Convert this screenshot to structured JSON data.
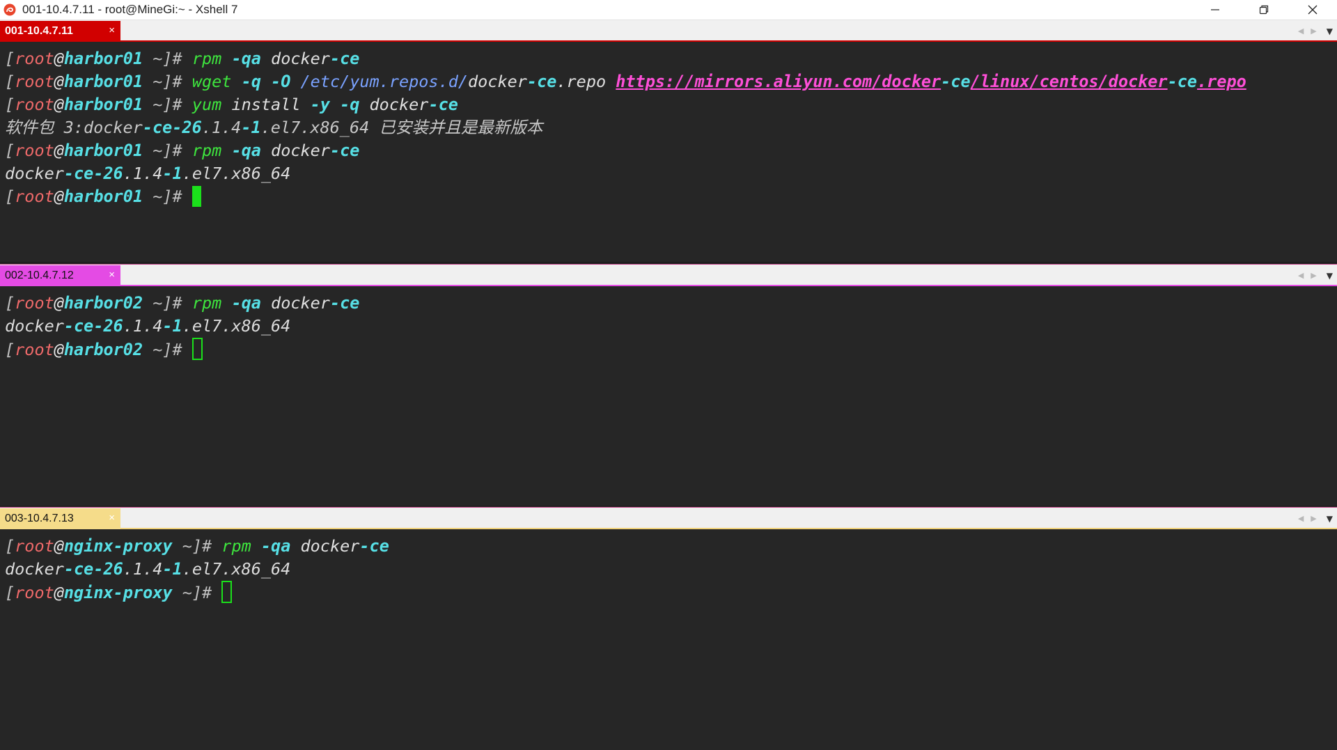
{
  "window": {
    "title": "001-10.4.7.11 - root@MineGi:~ - Xshell 7",
    "icon": "xshell-logo-icon",
    "controls": [
      "minimize-icon",
      "restore-icon",
      "close-icon"
    ]
  },
  "panes": [
    {
      "tab_label": "001-10.4.7.11",
      "tab_close": "×",
      "tab_color": "#d10000",
      "active": true,
      "lines": [
        [
          {
            "t": "[",
            "c": "br"
          },
          {
            "t": "root",
            "c": "user"
          },
          {
            "t": "@",
            "c": "at"
          },
          {
            "t": "harbor01",
            "c": "host"
          },
          {
            "t": " ~",
            "c": "tilde"
          },
          {
            "t": "]#",
            "c": "hash"
          },
          {
            "t": " ",
            "c": "arg"
          },
          {
            "t": "rpm",
            "c": "cmd"
          },
          {
            "t": " ",
            "c": "arg"
          },
          {
            "t": "-qa",
            "c": "flag"
          },
          {
            "t": " docker",
            "c": "arg"
          },
          {
            "t": "-ce",
            "c": "flag"
          }
        ],
        [
          {
            "t": "[",
            "c": "br"
          },
          {
            "t": "root",
            "c": "user"
          },
          {
            "t": "@",
            "c": "at"
          },
          {
            "t": "harbor01",
            "c": "host"
          },
          {
            "t": " ~",
            "c": "tilde"
          },
          {
            "t": "]#",
            "c": "hash"
          },
          {
            "t": " ",
            "c": "arg"
          },
          {
            "t": "wget",
            "c": "cmd"
          },
          {
            "t": " ",
            "c": "arg"
          },
          {
            "t": "-q",
            "c": "flag"
          },
          {
            "t": " ",
            "c": "arg"
          },
          {
            "t": "-O",
            "c": "flag"
          },
          {
            "t": " ",
            "c": "arg"
          },
          {
            "t": "/etc/yum.repos.d/",
            "c": "path"
          },
          {
            "t": "docker",
            "c": "arg"
          },
          {
            "t": "-ce",
            "c": "flag"
          },
          {
            "t": ".repo ",
            "c": "arg"
          },
          {
            "t": "https://mirrors.aliyun.com/docker",
            "c": "url"
          },
          {
            "t": "-ce",
            "c": "cyanb"
          },
          {
            "t": "/linux/centos/docker",
            "c": "url"
          },
          {
            "t": "-ce",
            "c": "cyanb"
          },
          {
            "t": ".repo",
            "c": "url"
          }
        ],
        [
          {
            "t": "[",
            "c": "br"
          },
          {
            "t": "root",
            "c": "user"
          },
          {
            "t": "@",
            "c": "at"
          },
          {
            "t": "harbor01",
            "c": "host"
          },
          {
            "t": " ~",
            "c": "tilde"
          },
          {
            "t": "]#",
            "c": "hash"
          },
          {
            "t": " ",
            "c": "arg"
          },
          {
            "t": "yum",
            "c": "cmd"
          },
          {
            "t": " install ",
            "c": "arg"
          },
          {
            "t": "-y",
            "c": "flag"
          },
          {
            "t": " ",
            "c": "arg"
          },
          {
            "t": "-q",
            "c": "flag"
          },
          {
            "t": " docker",
            "c": "arg"
          },
          {
            "t": "-ce",
            "c": "flag"
          }
        ],
        [
          {
            "t": "软件包 3:docker",
            "c": "note"
          },
          {
            "t": "-ce-26",
            "c": "num"
          },
          {
            "t": ".1.4",
            "c": "note"
          },
          {
            "t": "-1",
            "c": "num"
          },
          {
            "t": ".el7.x86_64 已安装并且是最新版本",
            "c": "note"
          }
        ],
        [
          {
            "t": "[",
            "c": "br"
          },
          {
            "t": "root",
            "c": "user"
          },
          {
            "t": "@",
            "c": "at"
          },
          {
            "t": "harbor01",
            "c": "host"
          },
          {
            "t": " ~",
            "c": "tilde"
          },
          {
            "t": "]#",
            "c": "hash"
          },
          {
            "t": " ",
            "c": "arg"
          },
          {
            "t": "rpm",
            "c": "cmd"
          },
          {
            "t": " ",
            "c": "arg"
          },
          {
            "t": "-qa",
            "c": "flag"
          },
          {
            "t": " docker",
            "c": "arg"
          },
          {
            "t": "-ce",
            "c": "flag"
          }
        ],
        [
          {
            "t": "docker",
            "c": "out"
          },
          {
            "t": "-ce-26",
            "c": "num"
          },
          {
            "t": ".1.4",
            "c": "out"
          },
          {
            "t": "-1",
            "c": "num"
          },
          {
            "t": ".el7.x86_64",
            "c": "out"
          }
        ],
        [
          {
            "t": "[",
            "c": "br"
          },
          {
            "t": "root",
            "c": "user"
          },
          {
            "t": "@",
            "c": "at"
          },
          {
            "t": "harbor01",
            "c": "host"
          },
          {
            "t": " ~",
            "c": "tilde"
          },
          {
            "t": "]#",
            "c": "hash"
          },
          {
            "t": " ",
            "c": "arg"
          },
          {
            "cursor": "solid"
          }
        ]
      ]
    },
    {
      "tab_label": "002-10.4.7.12",
      "tab_close": "×",
      "tab_color": "#e44be4",
      "active": false,
      "lines": [
        [
          {
            "t": "[",
            "c": "br"
          },
          {
            "t": "root",
            "c": "user"
          },
          {
            "t": "@",
            "c": "at"
          },
          {
            "t": "harbor02",
            "c": "host"
          },
          {
            "t": " ~",
            "c": "tilde"
          },
          {
            "t": "]#",
            "c": "hash"
          },
          {
            "t": " ",
            "c": "arg"
          },
          {
            "t": "rpm",
            "c": "cmd"
          },
          {
            "t": " ",
            "c": "arg"
          },
          {
            "t": "-qa",
            "c": "flag"
          },
          {
            "t": " docker",
            "c": "arg"
          },
          {
            "t": "-ce",
            "c": "flag"
          }
        ],
        [
          {
            "t": "docker",
            "c": "out"
          },
          {
            "t": "-ce-26",
            "c": "num"
          },
          {
            "t": ".1.4",
            "c": "out"
          },
          {
            "t": "-1",
            "c": "num"
          },
          {
            "t": ".el7.x86_64",
            "c": "out"
          }
        ],
        [
          {
            "t": "[",
            "c": "br"
          },
          {
            "t": "root",
            "c": "user"
          },
          {
            "t": "@",
            "c": "at"
          },
          {
            "t": "harbor02",
            "c": "host"
          },
          {
            "t": " ~",
            "c": "tilde"
          },
          {
            "t": "]#",
            "c": "hash"
          },
          {
            "t": " ",
            "c": "arg"
          },
          {
            "cursor": "hollow"
          }
        ]
      ]
    },
    {
      "tab_label": "003-10.4.7.13",
      "tab_close": "×",
      "tab_color": "#f5dc8a",
      "active": false,
      "lines": [
        [
          {
            "t": "[",
            "c": "br"
          },
          {
            "t": "root",
            "c": "user"
          },
          {
            "t": "@",
            "c": "at"
          },
          {
            "t": "nginx-proxy",
            "c": "host"
          },
          {
            "t": " ~",
            "c": "tilde"
          },
          {
            "t": "]#",
            "c": "hash"
          },
          {
            "t": " ",
            "c": "arg"
          },
          {
            "t": "rpm",
            "c": "cmd"
          },
          {
            "t": " ",
            "c": "arg"
          },
          {
            "t": "-qa",
            "c": "flag"
          },
          {
            "t": " docker",
            "c": "arg"
          },
          {
            "t": "-ce",
            "c": "flag"
          }
        ],
        [
          {
            "t": "docker",
            "c": "out"
          },
          {
            "t": "-ce-26",
            "c": "num"
          },
          {
            "t": ".1.4",
            "c": "out"
          },
          {
            "t": "-1",
            "c": "num"
          },
          {
            "t": ".el7.x86_64",
            "c": "out"
          }
        ],
        [
          {
            "t": "[",
            "c": "br"
          },
          {
            "t": "root",
            "c": "user"
          },
          {
            "t": "@",
            "c": "at"
          },
          {
            "t": "nginx-proxy",
            "c": "host"
          },
          {
            "t": " ~",
            "c": "tilde"
          },
          {
            "t": "]#",
            "c": "hash"
          },
          {
            "t": " ",
            "c": "arg"
          },
          {
            "cursor": "hollow"
          }
        ]
      ]
    }
  ]
}
